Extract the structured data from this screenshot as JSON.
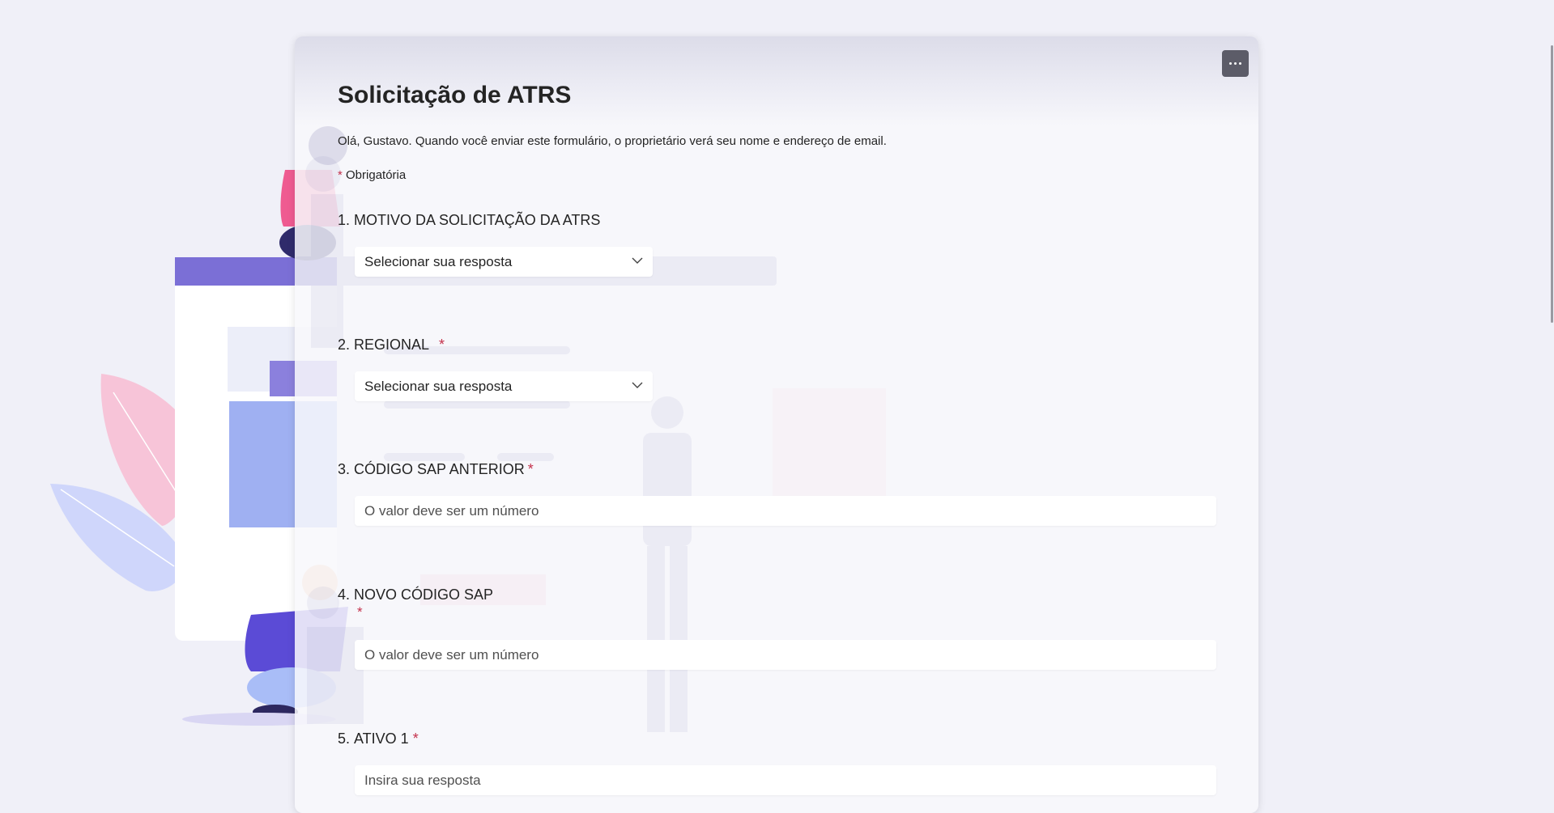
{
  "form": {
    "title": "Solicitação de ATRS",
    "intro": "Olá, Gustavo. Quando você enviar este formulário, o proprietário verá seu nome e endereço de email.",
    "required_marker": "*",
    "required_note": "Obrigatória",
    "more_options_icon": "more-horizontal-icon",
    "questions": [
      {
        "number": "1.",
        "label": "MOTIVO DA SOLICITAÇÃO DA ATRS",
        "required": false,
        "type": "select",
        "value": "Selecionar sua resposta"
      },
      {
        "number": "2.",
        "label": "REGIONAL",
        "required": true,
        "type": "select",
        "value": "Selecionar sua resposta"
      },
      {
        "number": "3.",
        "label": "CÓDIGO SAP ANTERIOR",
        "required": true,
        "type": "number",
        "placeholder": "O valor deve ser um número"
      },
      {
        "number": "4.",
        "label": "NOVO CÓDIGO SAP",
        "required": true,
        "type": "number",
        "placeholder": "O valor deve ser um número"
      },
      {
        "number": "5.",
        "label": "ATIVO 1",
        "required": true,
        "type": "text",
        "placeholder": "Insira sua resposta"
      }
    ]
  },
  "colors": {
    "page_background": "#f0f0f8",
    "required_star": "#c4314b",
    "accent_purple": "#7b6fd6",
    "more_button": "#5c5c68"
  }
}
